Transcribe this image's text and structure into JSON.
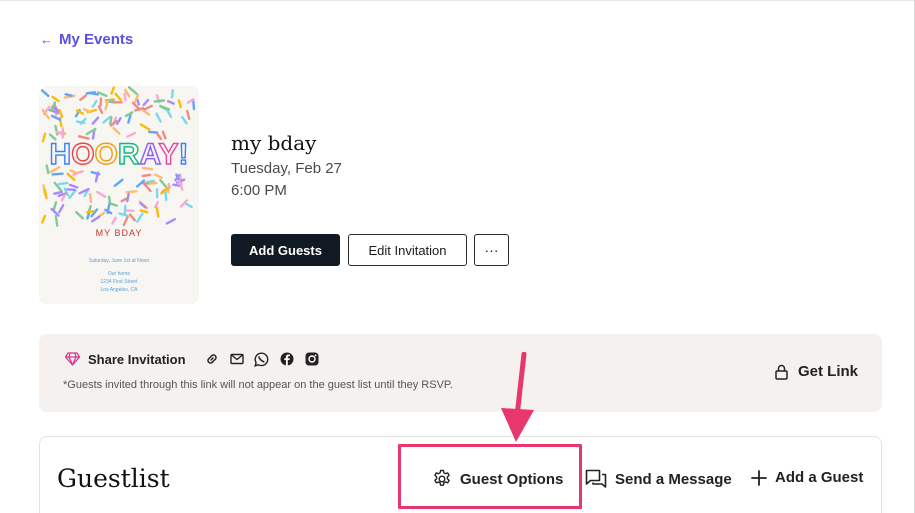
{
  "nav": {
    "back_label": "My Events",
    "back_icon": "arrow-left-icon"
  },
  "invitation_card": {
    "headline": "HOORAY!",
    "event_name": "MY BDAY",
    "date_line": "Saturday, June 1st at Noon",
    "address_line1": "Our home",
    "address_line2": "1234 First Street",
    "address_line3": "Los Angeles, CA"
  },
  "event": {
    "title": "my bday",
    "date": "Tuesday, Feb 27",
    "time": "6:00 PM"
  },
  "actions": {
    "add_guests": "Add Guests",
    "edit_invitation": "Edit Invitation",
    "more": "···"
  },
  "share": {
    "label": "Share Invitation",
    "icons": [
      "diamond-icon",
      "link-icon",
      "mail-icon",
      "whatsapp-icon",
      "facebook-icon",
      "instagram-icon"
    ],
    "note": "*Guests invited through this link will not appear on the guest list until they RSVP.",
    "get_link": "Get Link"
  },
  "guestlist": {
    "title": "Guestlist",
    "guest_options": "Guest Options",
    "send_message": "Send a Message",
    "add_guest": "Add a Guest"
  },
  "colors": {
    "accent": "#5b4fe0",
    "primary_button": "#111a22",
    "share_panel_bg": "#f4f1ef",
    "annotation": "#e8376c"
  }
}
